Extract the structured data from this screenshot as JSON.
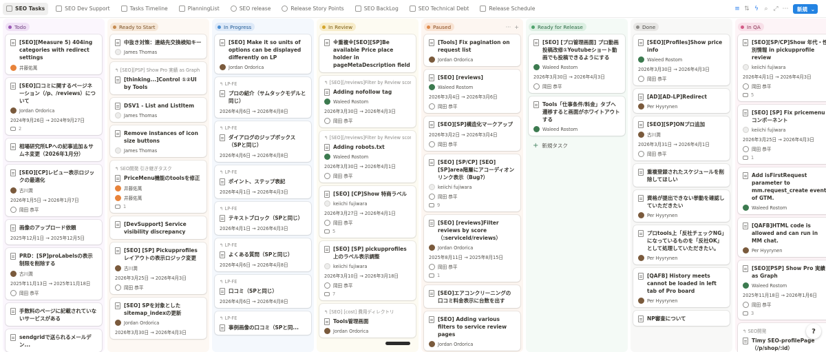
{
  "tabs": [
    {
      "label": "SEO Tasks",
      "icon": "table-icon",
      "active": true
    },
    {
      "label": "SEO Dev Support",
      "icon": "table-icon"
    },
    {
      "label": "Tasks Timeline",
      "icon": "timeline-icon"
    },
    {
      "label": "PlanningList",
      "icon": "table-icon"
    },
    {
      "label": "SEO release",
      "icon": "clock-icon"
    },
    {
      "label": "Release Story Points",
      "icon": "clock-icon"
    },
    {
      "label": "SEO BackLog",
      "icon": "table-icon"
    },
    {
      "label": "SEO Technical Debt",
      "icon": "table-icon"
    },
    {
      "label": "Release Schedule",
      "icon": "list-icon"
    }
  ],
  "toolbar": {
    "new_label": "新規",
    "chevron": "⌄"
  },
  "colors": {
    "accent": "#2383e2"
  },
  "add_task_label": "新規タスク",
  "columns": [
    {
      "name": "Todo",
      "bg": "#fbf6fd",
      "pill_bg": "#efe0f5",
      "pill_fg": "#6c3b7e",
      "dot": "#9b59b6",
      "cards": [
        {
          "title": "[SEO][Measure 5) 404ing categories with redirect settings",
          "people": [
            {
              "name": "井藤佑萬",
              "av": "orange"
            }
          ]
        },
        {
          "title": "[SEO]口コミに関するページネーション（/p、/reviews）について",
          "people": [
            {
              "name": "Jordan Ordorica",
              "av": "brown"
            }
          ],
          "date": "2024年9月26日 → 2024年9月27日",
          "comments": "2"
        },
        {
          "title": "相場研究所LPへの記事追加＆サムネ変更（2026年1月分）"
        },
        {
          "title": "[SEO][CP]レビュー表示ロジックの最適化",
          "people": [
            {
              "name": "古川潤",
              "av": "brown"
            }
          ],
          "date": "2026年1月5日 → 2026年1月7日",
          "people2": [
            {
              "name": "岡田 恭平",
              "av": "outline"
            }
          ]
        },
        {
          "title": "画像のアップロード依頼",
          "date": "2025年12月1日 → 2025年12月5日"
        },
        {
          "title": "PRD：[SP]proLabelsの表示制限を削除する",
          "people": [
            {
              "name": "古川潤",
              "av": "brown"
            }
          ],
          "date": "2025年11月13日 → 2025年11月18日",
          "people2": [
            {
              "name": "岡田 恭平",
              "av": "outline"
            }
          ]
        },
        {
          "title": "手数料のページに記載されていないサービスがある"
        },
        {
          "title": "sendgridで送られるメールデン..."
        }
      ]
    },
    {
      "name": "Ready to Start",
      "bg": "#fdf8f3",
      "pill_bg": "#f5e6d6",
      "pill_fg": "#7a4f22",
      "dot": "#c68a4e",
      "cards": [
        {
          "title": "中抜き対策：連絡先交換検知キー",
          "people": [
            {
              "name": "James Thomas",
              "av": "gray"
            }
          ]
        },
        {
          "parent": "[SEO][PSP] Show Pro 実績 as Graph",
          "title": "[thinking...]Control ①②UI by Tools"
        },
        {
          "title": "DSV1 - List and ListItem",
          "people": [
            {
              "name": "James Thomas",
              "av": "gray"
            }
          ]
        },
        {
          "title": "Remove instances of icon size buttons",
          "people": [
            {
              "name": "James Thomas",
              "av": "gray"
            }
          ]
        },
        {
          "parent": "SEO開発 引き継ぎタスク",
          "title": "PriceMenu機能のtoolsを修正",
          "people": [
            {
              "name": "井藤佑萬",
              "av": "orange"
            },
            {
              "name": "井藤佑萬",
              "av": "orange"
            }
          ],
          "comments": "1"
        },
        {
          "title": "[DevSupport] Service visibility discrepancy"
        },
        {
          "title": "[SEO] [SP] Pickupprofilesレイアウトの表示ロジック変更",
          "people": [
            {
              "name": "古川潤",
              "av": "brown"
            }
          ],
          "date": "2026年3月25日 → 2026年4月3日",
          "people2": [
            {
              "name": "岡田 恭平",
              "av": "outline"
            }
          ]
        },
        {
          "title": "[SEO] SPを対象としたsitemap_indexの更新",
          "people": [
            {
              "name": "Jordan Ordorica",
              "av": "brown"
            }
          ],
          "date": "2026年3月30日 → 2026年4月3日"
        }
      ]
    },
    {
      "name": "In Progress",
      "bg": "#f4f8fd",
      "pill_bg": "#dde9f8",
      "pill_fg": "#1f5a96",
      "dot": "#4a8fd4",
      "cards": [
        {
          "title": "[SEO] Make it so units of options can be displayed differently on LP",
          "people": [
            {
              "name": "Jordan Ordorica",
              "av": "brown"
            }
          ]
        },
        {
          "parent": "LP-FE",
          "title": "プロの紹介（サムタックモデルと同じ）",
          "date": "2026年4月6日 → 2026年4月8日"
        },
        {
          "parent": "LP-FE",
          "title": "ダイアログのジップボックス（SPと同じ）",
          "date": "2026年4月6日 → 2026年4月8日"
        },
        {
          "parent": "LP-FE",
          "title": "ポイント、ステップ表記",
          "date": "2026年4月1日 → 2026年4月3日"
        },
        {
          "parent": "LP-FE",
          "title": "テキストブロック（SPと同じ）",
          "date": "2026年4月1日 → 2026年4月3日"
        },
        {
          "parent": "LP-FE",
          "title": "よくある質問（SPと同じ）",
          "date": "2026年4月6日 → 2026年4月8日"
        },
        {
          "parent": "LP-FE",
          "title": "口コミ（SPと同じ）",
          "date": "2026年4月6日 → 2026年4月8日"
        },
        {
          "parent": "LP-FE",
          "title": "事例画像の口コミ（SPと同..."
        }
      ]
    },
    {
      "name": "In Review",
      "bg": "#fdfbf2",
      "pill_bg": "#f7ecc9",
      "pill_fg": "#7a5c10",
      "dot": "#d4a52a",
      "cards": [
        {
          "title": "※重複※[SEO][SP]Be available Price place holder in pageMetaDescription field"
        },
        {
          "parent": "[SEO][/reviews]Filter by Review scores",
          "title": "Adding nofollow tag",
          "people": [
            {
              "name": "Waleed Rostom",
              "av": "green"
            }
          ],
          "date": "2026年3月30日 → 2026年4月3日",
          "people2": [
            {
              "name": "岡田 恭平",
              "av": "outline"
            }
          ]
        },
        {
          "parent": "[SEO][/reviews]Filter by Review scores",
          "title": "Adding robots.txt",
          "people": [
            {
              "name": "Waleed Rostom",
              "av": "green"
            }
          ],
          "date": "2026年3月30日 → 2026年4月1日",
          "people2": [
            {
              "name": "岡田 恭平",
              "av": "outline"
            }
          ]
        },
        {
          "title": "[SEO] [CP]Show 特商ラベル",
          "people": [
            {
              "name": "keiichi fujiwara",
              "av": "gray"
            }
          ],
          "date": "2026年3月27日 → 2026年4月1日",
          "people2": [
            {
              "name": "岡田 恭平",
              "av": "outline"
            }
          ],
          "comments": "5"
        },
        {
          "title": "[SEO] [SP] pickupprofiles上のラベル表示調整",
          "people": [
            {
              "name": "keiichi fujiwara",
              "av": "gray"
            }
          ],
          "date": "2026年3月10日 → 2026年3月18日",
          "people2": [
            {
              "name": "岡田 恭平",
              "av": "outline"
            }
          ],
          "comments": "7"
        },
        {
          "parent": "[SEO] [cost] 費用ディレクトリ",
          "title": "Tools管理画面",
          "people": [
            {
              "name": "Jordan Ordorica",
              "av": "brown"
            }
          ]
        }
      ]
    },
    {
      "name": "Paused",
      "bg": "#fdf6f1",
      "pill_bg": "#f9e3d3",
      "pill_fg": "#8a4a1c",
      "dot": "#e08a4a",
      "cards": [
        {
          "title": "[Tools] Fix pagination on request list",
          "people": [
            {
              "name": "Jordan Ordorica",
              "av": "brown"
            }
          ]
        },
        {
          "title": "[SEO] [reviews]",
          "people": [
            {
              "name": "Waleed Rostom",
              "av": "green"
            }
          ],
          "date": "2026年3月4日 → 2026年3月6日",
          "people2": [
            {
              "name": "岡田 恭平",
              "av": "outline"
            }
          ]
        },
        {
          "title": "[SEO][SP]構造化マークアップ",
          "date": "2026年3月2日 → 2026年3月4日",
          "people2": [
            {
              "name": "岡田 恭平",
              "av": "outline"
            }
          ]
        },
        {
          "title": "[SEO] [SP/CP] [SEO][SP]area階層にアコーディオンリンク表示（Bug?）",
          "people": [
            {
              "name": "keiichi fujiwara",
              "av": "gray"
            }
          ],
          "people2": [
            {
              "name": "岡田 恭平",
              "av": "outline"
            }
          ],
          "comments": "9"
        },
        {
          "title": "[SEO] [reviews]Filter reviews by score （:serviceId/reviews）",
          "people": [
            {
              "name": "Jordan Ordorica",
              "av": "brown"
            }
          ],
          "date": "2025年8月11日 → 2025年8月15日",
          "people2": [
            {
              "name": "岡田 恭平",
              "av": "outline"
            }
          ],
          "comments": "1"
        },
        {
          "title": "[SEO]エアコンクリーニングの口コミ料金表示に台数を出す"
        },
        {
          "title": "[SEO] Adding various filters to service review pages",
          "people": [
            {
              "name": "Jordan Ordorica",
              "av": "brown"
            }
          ]
        }
      ]
    },
    {
      "name": "Ready for Release",
      "bg": "#f4faf6",
      "pill_bg": "#dcefe2",
      "pill_fg": "#2a6a44",
      "dot": "#4fa36c",
      "cards": [
        {
          "title": "[SEO] [プロ管理画面] プロ動画投稿改修①Youtubeショート動画でも投稿できるようにする",
          "people": [
            {
              "name": "Waleed Rostom",
              "av": "green"
            }
          ],
          "date": "2026年3月30日 → 2026年4月3日",
          "people2": [
            {
              "name": "岡田 恭平",
              "av": "outline"
            }
          ]
        },
        {
          "title": "Tools「仕事条件/料金」タブへ遷移すると画面がホワイトアウトする",
          "people": [
            {
              "name": "Waleed Rostom",
              "av": "green"
            }
          ]
        }
      ],
      "add_task": true
    },
    {
      "name": "Done",
      "bg": "#f8f8f7",
      "pill_bg": "#e7e6e4",
      "pill_fg": "#4a4945",
      "dot": "#8e8d8a",
      "cards": [
        {
          "title": "[SEO][Profiles]Show price info",
          "people": [
            {
              "name": "Waleed Rostom",
              "av": "green"
            }
          ],
          "date": "2026年3月30日 → 2026年4月3日",
          "people2": [
            {
              "name": "岡田 恭平",
              "av": "outline"
            }
          ]
        },
        {
          "title": "[AD][AD-LP]Redirect",
          "people": [
            {
              "name": "Per Hyyrynen",
              "av": "brown"
            }
          ]
        },
        {
          "title": "[SEO][SP]ONプロ追加",
          "people": [
            {
              "name": "古川潤",
              "av": "brown"
            }
          ],
          "date": "2026年3月31日 → 2026年4月1日",
          "people2": [
            {
              "name": "岡田 恭平",
              "av": "outline"
            }
          ]
        },
        {
          "title": "重複登録されたスケジュールを削除してほしい"
        },
        {
          "title": "資格が提出できない挙動を確認していただきたい",
          "people": [
            {
              "name": "Per Hyyrynen",
              "av": "brown"
            }
          ]
        },
        {
          "title": "プロtools上「反社チェックNG」になっているものを「反社OK」として処理していただきたい。",
          "people": [
            {
              "name": "Per Hyyrynen",
              "av": "brown"
            }
          ]
        },
        {
          "title": "[QAFB] History meets cannot be loaded in left tab of Pro board",
          "people": [
            {
              "name": "Per Hyyrynen",
              "av": "brown"
            }
          ]
        },
        {
          "title": "NP審査について"
        }
      ]
    },
    {
      "name": "In QA",
      "bg": "#fdf4f7",
      "pill_bg": "#f8dfe8",
      "pill_fg": "#8a2f52",
      "dot": "#d45b87",
      "cards": [
        {
          "title": "[SEO][SP/CP]Show 年代・性別情報 in pickupprofile review",
          "people": [
            {
              "name": "keiichi fujiwara",
              "av": "gray"
            }
          ],
          "date": "2026年4月1日 → 2026年4月3日",
          "people2": [
            {
              "name": "岡田 恭平",
              "av": "outline"
            }
          ],
          "comments": "5"
        },
        {
          "title": "[SEO] [SP] Fix pricemenuコンポーネント",
          "people": [
            {
              "name": "keiichi fujiwara",
              "av": "gray"
            }
          ],
          "date": "2026年3月25日 → 2026年4月3日",
          "people2": [
            {
              "name": "岡田 恭平",
              "av": "outline"
            }
          ],
          "comments": "1"
        },
        {
          "title": "Add isFirstRequest parameter to mm.request_create event of GTM.",
          "people": [
            {
              "name": "Waleed Rostom",
              "av": "green"
            }
          ]
        },
        {
          "title": "[QAFB]HTML code is allowed and can run in MM chat.",
          "people": [
            {
              "name": "Per Hyyrynen",
              "av": "brown"
            }
          ]
        },
        {
          "title": "[SEO][PSP] Show Pro 実績 as Graph",
          "people": [
            {
              "name": "Waleed Rostom",
              "av": "green"
            }
          ],
          "date": "2025年11月18日 → 2026年1月6日",
          "people2": [
            {
              "name": "岡田 恭平",
              "av": "outline"
            }
          ],
          "comments": "3"
        },
        {
          "parent": "SEO開発",
          "title": "Timy SEO-profilePage（/p/shop/:id）",
          "people": [
            {
              "name": "Waleed Rostom",
              "av": "green"
            }
          ]
        }
      ]
    }
  ]
}
